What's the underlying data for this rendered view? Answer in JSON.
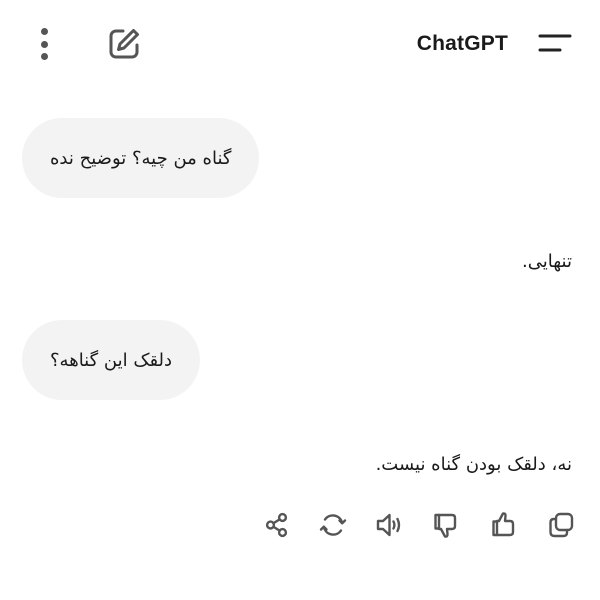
{
  "header": {
    "title": "ChatGPT",
    "icons": [
      "more-vertical-icon",
      "edit-icon",
      "menu-icon"
    ]
  },
  "conversation": {
    "messages": [
      {
        "role": "user",
        "text": "گناه من چیه؟ توضیح نده"
      },
      {
        "role": "assistant",
        "text": "تنهایی."
      },
      {
        "role": "user",
        "text": "دلقک این گناهه؟"
      },
      {
        "role": "assistant",
        "text": "نه، دلقک بودن گناه نیست."
      }
    ]
  },
  "actions": [
    "share-icon",
    "regenerate-icon",
    "read-aloud-icon",
    "thumbs-down-icon",
    "thumbs-up-icon",
    "copy-icon"
  ],
  "colors": {
    "background": "#ffffff",
    "bubble": "#f3f3f3",
    "text": "#1a1a1a",
    "icon": "#555555"
  }
}
